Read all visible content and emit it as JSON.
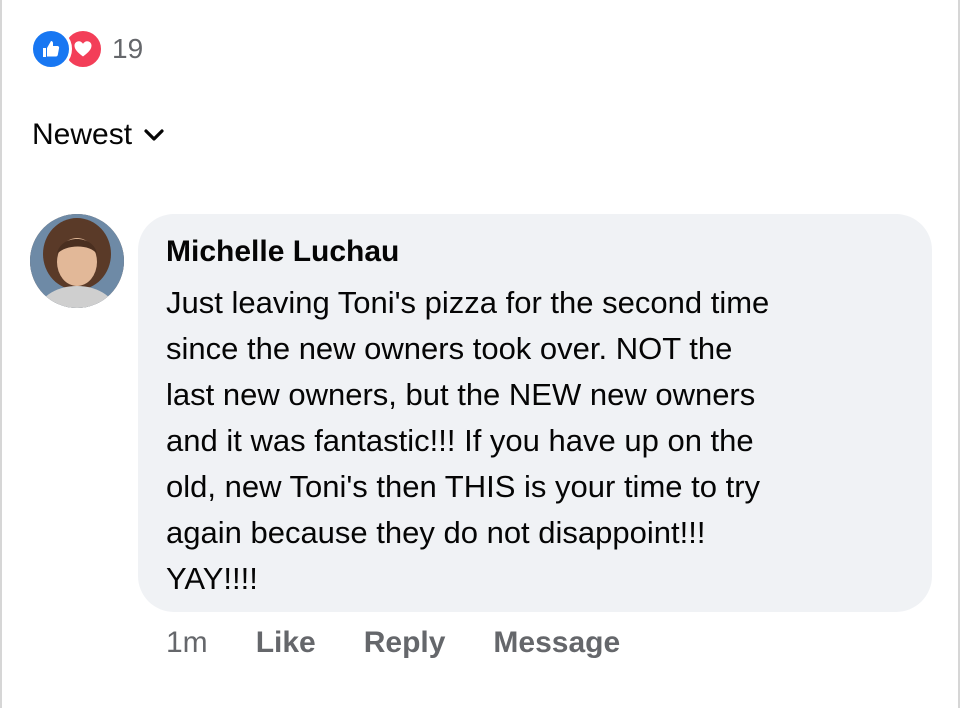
{
  "reactions": {
    "count": "19",
    "icons": [
      "like-icon",
      "love-icon"
    ],
    "like_color": "#1877f2",
    "love_color": "#f33e58"
  },
  "sort": {
    "label": "Newest",
    "icon": "chevron-down-icon"
  },
  "comment": {
    "author": "Michelle Luchau",
    "text": "Just leaving Toni's pizza for the second time\nsince the new owners took over.  NOT the\nlast new owners,  but the NEW new owners\nand it was fantastic!!!  If you have up on the\nold, new Toni's then THIS is your time to try\nagain because they do not disappoint!!!\nYAY!!!!",
    "timestamp": "1m",
    "actions": {
      "like": "Like",
      "reply": "Reply",
      "message": "Message"
    },
    "bubble_color": "#f0f2f5"
  }
}
